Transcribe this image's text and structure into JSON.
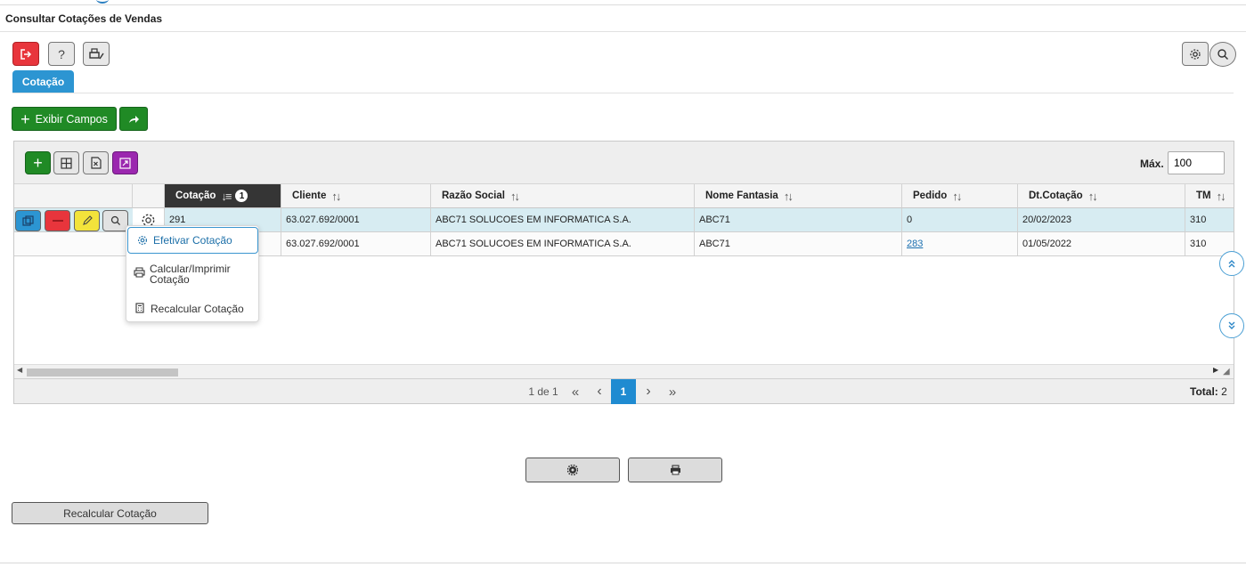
{
  "page": {
    "title": "Consultar Cotações de Vendas"
  },
  "icons": {
    "exit": "exit-icon",
    "help": "question-icon",
    "print_edit": "printer-edit-icon",
    "gear": "gear-icon",
    "search": "search-icon",
    "plus": "plus-icon",
    "share": "share-arrow-icon",
    "grid": "grid-icon",
    "excel": "excel-icon",
    "expand": "expand-icon",
    "copy": "copy-icon",
    "delete": "minus-icon",
    "edit": "pencil-icon",
    "view": "magnifier-icon",
    "scroll_up": "chevrons-up-icon",
    "scroll_down": "chevrons-down-icon"
  },
  "colors": {
    "accent": "#2c95d2",
    "green": "#208a25",
    "red": "#e8353c",
    "yellow": "#f3e33b",
    "purple": "#9b27af"
  },
  "toolbar": {
    "help_label": "?"
  },
  "tabs": [
    {
      "label": "Cotação",
      "active": true
    }
  ],
  "actions": {
    "exibir_campos": "Exibir Campos"
  },
  "grid": {
    "max_label": "Máx.",
    "max_value": "100",
    "columns": [
      {
        "label": "Cotação",
        "sort": "↓≡",
        "badge": "1",
        "active": true
      },
      {
        "label": "Cliente",
        "sort": "↑↓"
      },
      {
        "label": "Razão Social",
        "sort": "↑↓"
      },
      {
        "label": "Nome Fantasia",
        "sort": "↑↓"
      },
      {
        "label": "Pedido",
        "sort": "↑↓"
      },
      {
        "label": "Dt.Cotação",
        "sort": "↑↓"
      },
      {
        "label": "TM",
        "sort": "↑↓"
      }
    ],
    "rows": [
      {
        "cotacao": "291",
        "cliente": "63.027.692/0001",
        "razao": "ABC71 SOLUCOES EM INFORMATICA S.A.",
        "fantasia": "ABC71",
        "pedido": "0",
        "dt": "20/02/2023",
        "tm": "310"
      },
      {
        "cotacao": "",
        "cliente": "63.027.692/0001",
        "razao": "ABC71 SOLUCOES EM INFORMATICA S.A.",
        "fantasia": "ABC71",
        "pedido": "283",
        "dt": "01/05/2022",
        "tm": "310"
      }
    ],
    "pagination": {
      "info": "1 de 1",
      "first": "«",
      "prev": "‹",
      "current": "1",
      "next": "›",
      "last": "»",
      "total_label": "Total:",
      "total_value": "2"
    }
  },
  "context_menu": {
    "items": [
      {
        "label": "Efetivar Cotação",
        "icon": "gear-icon"
      },
      {
        "label": "Calcular/Imprimir Cotação",
        "icon": "printer-icon"
      },
      {
        "label": "Recalcular Cotação",
        "icon": "calculator-icon"
      }
    ]
  },
  "bottom": {
    "recalcular_label": "Recalcular Cotação"
  }
}
